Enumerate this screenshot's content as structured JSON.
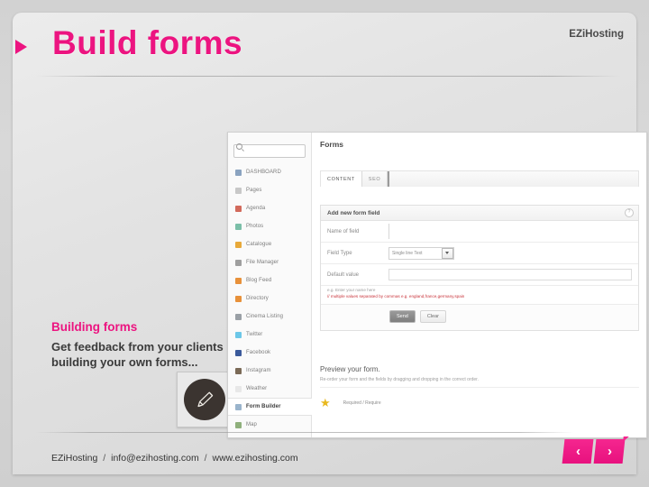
{
  "slide": {
    "title": "Build forms",
    "brand": "EZiHosting",
    "marker_icon": "play-triangle-icon"
  },
  "copy": {
    "heading": "Building forms",
    "body": "Get feedback from your clients by building your own forms...",
    "thumb_icon": "pencil-icon"
  },
  "screenshot": {
    "search": {
      "placeholder": "",
      "icon": "search-icon"
    },
    "sidebar": [
      {
        "label": "DASHBOARD",
        "icon": "dashboard-icon",
        "color": "#8aa3c0",
        "active": false
      },
      {
        "label": "Pages",
        "icon": "pages-icon",
        "color": "#c8c8c8",
        "active": false
      },
      {
        "label": "Agenda",
        "icon": "agenda-icon",
        "color": "#d26a5c",
        "active": false
      },
      {
        "label": "Photos",
        "icon": "photos-icon",
        "color": "#7bbfa8",
        "active": false
      },
      {
        "label": "Catalogue",
        "icon": "catalogue-icon",
        "color": "#e8a93a",
        "active": false
      },
      {
        "label": "File Manager",
        "icon": "file-manager-icon",
        "color": "#9f9f9f",
        "active": false
      },
      {
        "label": "Blog Feed",
        "icon": "blog-feed-icon",
        "color": "#e8913a",
        "active": false
      },
      {
        "label": "Directory",
        "icon": "directory-icon",
        "color": "#e8913a",
        "active": false
      },
      {
        "label": "Cinema Listing",
        "icon": "cinema-listing-icon",
        "color": "#9aa0a6",
        "active": false
      },
      {
        "label": "Twitter",
        "icon": "twitter-icon",
        "color": "#6cc7e8",
        "active": false
      },
      {
        "label": "Facebook",
        "icon": "facebook-icon",
        "color": "#3b5a9b",
        "active": false
      },
      {
        "label": "Instagram",
        "icon": "instagram-icon",
        "color": "#7b6a57",
        "active": false
      },
      {
        "label": "Weather",
        "icon": "weather-icon",
        "color": "#e8e8e8",
        "active": false
      },
      {
        "label": "Form Builder",
        "icon": "form-builder-icon",
        "color": "#9ab4cc",
        "active": true
      },
      {
        "label": "Map",
        "icon": "map-icon",
        "color": "#8fb07c",
        "active": false
      }
    ],
    "pane_title": "Forms",
    "tabs": [
      {
        "label": "CONTENT",
        "selected": true
      },
      {
        "label": "SEO",
        "selected": false
      }
    ],
    "panel": {
      "title": "Add new form field",
      "help_icon": "question-mark-icon",
      "name_label": "Name of field",
      "name_value": "",
      "field_type_label": "Field Type",
      "field_type_value": "Single line Text",
      "default_label": "Default value",
      "default_value": "",
      "hint_grey": "e.g. Enter your name here",
      "hint_red": "// multiple values separated by commas e.g. england,france,germany,spain",
      "send_label": "Send",
      "clear_label": "Clear"
    },
    "preview": {
      "title": "Preview your form.",
      "subtitle": "Re-order your form and the fields by dragging and dropping in the correct order.",
      "star_icon": "star-icon",
      "required_label": "Required / Require"
    }
  },
  "footer": {
    "company": "EZiHosting",
    "email": "info@ezihosting.com",
    "website": "www.ezihosting.com",
    "separator": "/",
    "prev_label": "‹",
    "next_label": "›"
  },
  "colors": {
    "accent": "#ec1480",
    "nav": "#f5268f"
  }
}
